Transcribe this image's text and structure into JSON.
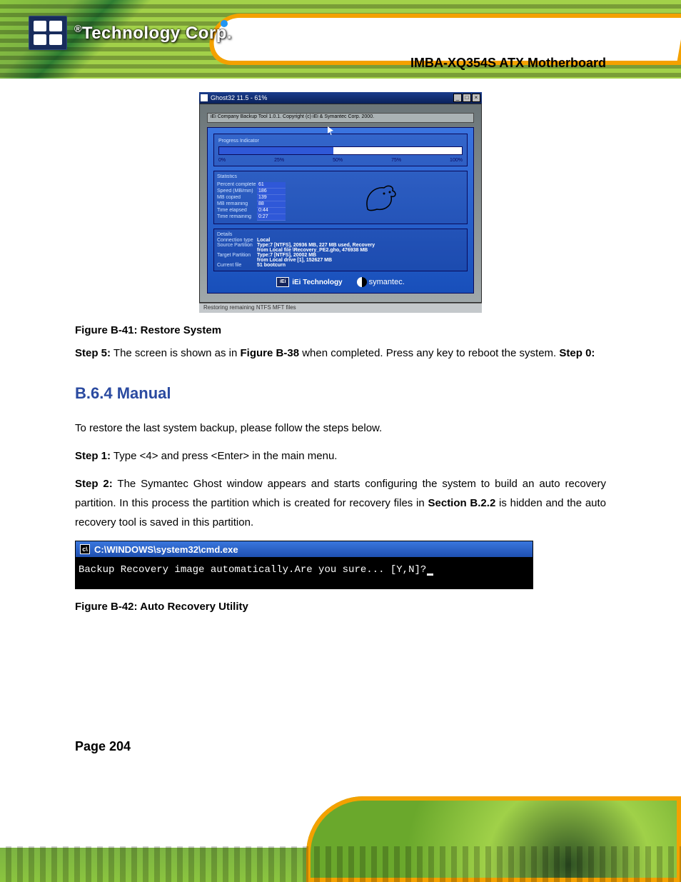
{
  "header": {
    "product": "IMBA-XQ354S ATX Motherboard",
    "logo_text": "Technology Corp."
  },
  "ghost_window": {
    "title": "Ghost32 11.5 - 61%",
    "copyright": "iEi Company Backup Tool 1.0.1.  Copyright (c) iEi & Symantec Corp. 2000.",
    "progress": {
      "section": "Progress Indicator",
      "ticks": [
        "0%",
        "25%",
        "50%",
        "75%",
        "100%"
      ],
      "percent": 47
    },
    "statistics": {
      "section": "Statistics",
      "rows": [
        {
          "label": "Percent complete",
          "value": "61"
        },
        {
          "label": "Speed (MB/min)",
          "value": "186"
        },
        {
          "label": "MB copied",
          "value": "139"
        },
        {
          "label": "MB remaining",
          "value": "88"
        },
        {
          "label": "Time elapsed",
          "value": "0:44"
        },
        {
          "label": "Time remaining",
          "value": "0:27"
        }
      ]
    },
    "details": {
      "section": "Details",
      "rows": [
        {
          "label": "Connection type",
          "value": "Local"
        },
        {
          "label": "Source Partition",
          "value": "Type:7 [NTFS], 20936 MB, 227 MB used, Recovery"
        },
        {
          "label": "",
          "value": "from Local file \\Recovery_PE2.gho, 476938 MB"
        },
        {
          "label": "Target Partition",
          "value": "Type:7 [NTFS], 20002 MB"
        },
        {
          "label": "",
          "value": "from Local drive [1], 152627 MB"
        },
        {
          "label": "Current file",
          "value": "51 bootcurn"
        }
      ]
    },
    "footer": {
      "iei": "iEi Technology",
      "symantec": "symantec."
    },
    "status": "Restoring remaining NTFS MFT files"
  },
  "figure41": {
    "caption": "Figure B-41: Restore System"
  },
  "step5": {
    "label": "Step 5:",
    "text_a": "The screen is shown as in ",
    "ref": "Figure B-38",
    "text_b": " when completed. Press any key to reboot the system."
  },
  "section": {
    "heading": "B.6.4 Manual",
    "intro": "To restore the last system backup, please follow the steps below.",
    "step1": {
      "label": "Step 1:",
      "text": "Type <4> and press <Enter> in the main menu."
    },
    "step2": {
      "label": "Step 2:",
      "text_a": "The Symantec Ghost window appears and starts configuring the system to build an auto recovery partition. In this process the partition which is created for recovery files in ",
      "ref": "Section B.2.2",
      "text_b": " is hidden and the auto recovery tool is saved in this partition."
    }
  },
  "cmd": {
    "title": "C:\\WINDOWS\\system32\\cmd.exe",
    "body": "Backup Recovery image automatically.Are you sure... [Y,N]?"
  },
  "figure42": {
    "caption": "Figure B-42: Auto Recovery Utility"
  },
  "page_number": "Page 204"
}
